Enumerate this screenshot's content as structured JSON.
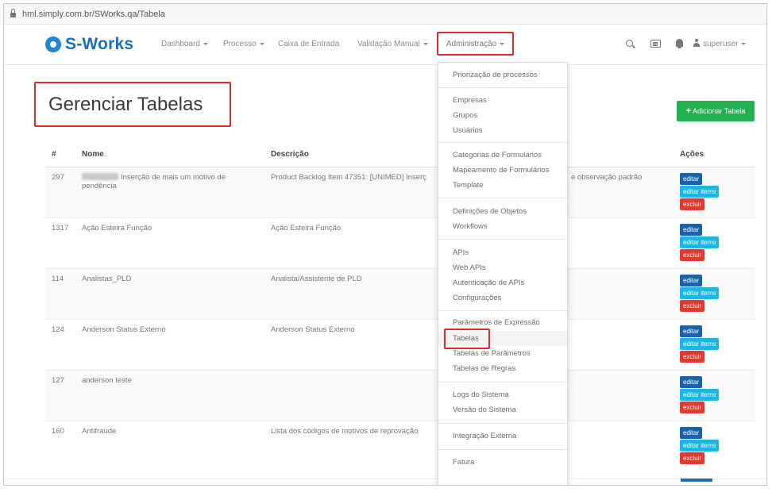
{
  "browser": {
    "url": "hml.simply.com.br/SWorks.qa/Tabela"
  },
  "brand": {
    "name": "S-Works",
    "color": "#1570b9"
  },
  "nav": {
    "items": [
      {
        "label": "Dashboard"
      },
      {
        "label": "Processo"
      },
      {
        "label": "Caixa de Entrada"
      },
      {
        "label": "Validação Manual"
      }
    ],
    "admin_label": "Administração",
    "user_label": "superuser"
  },
  "page": {
    "title": "Gerenciar Tabelas",
    "add_button": "Adicionar Tabela"
  },
  "table": {
    "headers": {
      "id": "#",
      "nome": "Nome",
      "descricao": "Descrição",
      "acoes": "Ações"
    },
    "action_labels": {
      "edit": "editar",
      "items": "editar items",
      "delete": "excluir"
    },
    "rows": [
      {
        "id": "297",
        "nome": "Inserção de mais um motivo de pendência",
        "descricao": "Product Backlog Item 47351: [UNIMED] Inserç",
        "descricao_tail": "e observação padrão"
      },
      {
        "id": "1317",
        "nome": "Ação Esteira Função",
        "descricao": "Ação Esteira Função",
        "descricao_tail": ""
      },
      {
        "id": "114",
        "nome": "Analistas_PLD",
        "descricao": "Analista/Assistente de PLD",
        "descricao_tail": ""
      },
      {
        "id": "124",
        "nome": "Anderson Status Externo",
        "descricao": "Anderson Status Externo",
        "descricao_tail": ""
      },
      {
        "id": "127",
        "nome": "anderson teste",
        "descricao": "",
        "descricao_tail": ""
      },
      {
        "id": "160",
        "nome": "Antifraude",
        "descricao": "Lista dos códigos de motivos de reprovação",
        "descricao_tail": ""
      }
    ]
  },
  "admin_menu": {
    "items": [
      "Priorização de processos",
      "Empresas",
      "Grupos",
      "Usuários",
      "Categorias de Formulários",
      "Mapeamento de Formulários",
      "Template",
      "Definições de Objetos",
      "Workflows",
      "APIs",
      "Web APIs",
      "Autenticação de APIs",
      "Configurações",
      "Parâmetros de Expressão",
      "Tabelas",
      "Tabelas de Parâmetros",
      "Tabelas de Regras",
      "Logs do Sistema",
      "Versão do Sistema",
      "Integração Externa",
      "Fatura"
    ],
    "active": "Tabelas"
  },
  "colors": {
    "highlight": "#e3262b",
    "add_button": "#23b14d",
    "edit": "#1a63a6",
    "edit_items": "#1fb5df",
    "delete": "#de3b34"
  },
  "icons": [
    "lock-icon",
    "logo-icon",
    "search-icon",
    "keyboard-icon",
    "bell-icon",
    "user-icon",
    "plus-icon",
    "caret-down-icon"
  ]
}
